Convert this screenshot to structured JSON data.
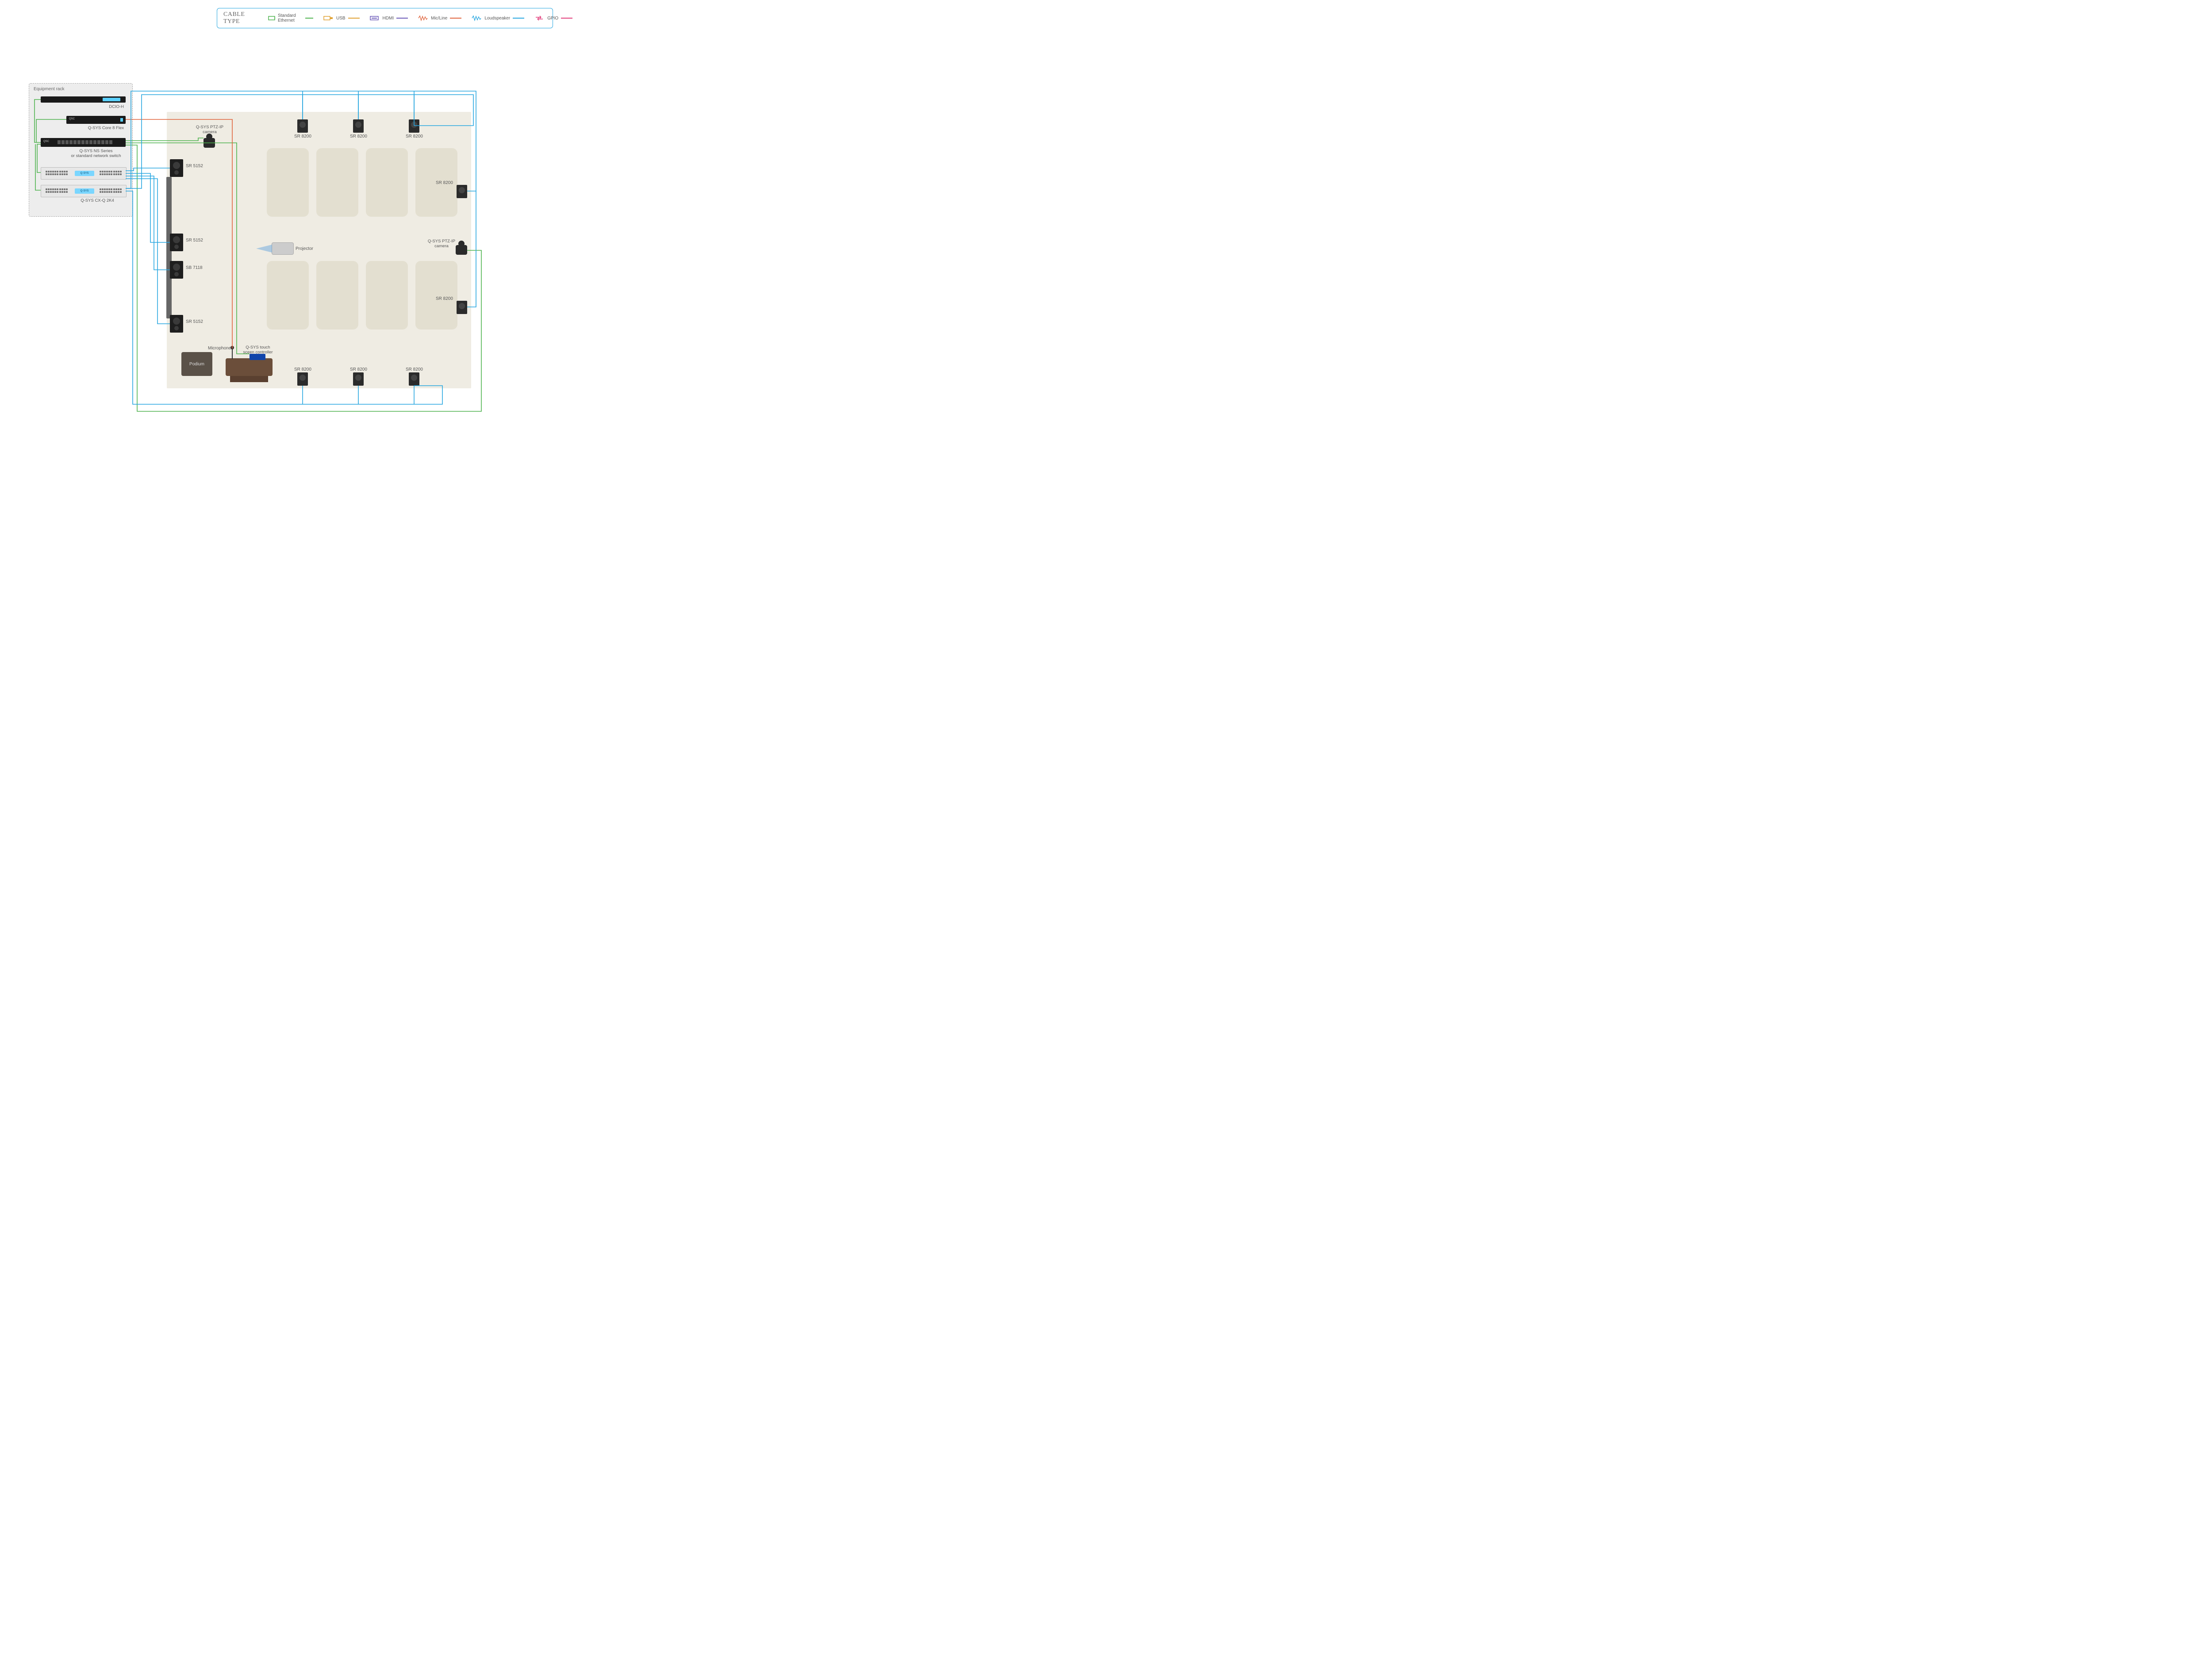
{
  "legend": {
    "title": "CABLE TYPE",
    "items": [
      {
        "label": "Standard Ethernet",
        "color": "#4db24d"
      },
      {
        "label": "USB",
        "color": "#e0a030"
      },
      {
        "label": "HDMI",
        "color": "#6a58b8"
      },
      {
        "label": "Mic/Line",
        "color": "#e0623a"
      },
      {
        "label": "Loudspeaker",
        "color": "#26a6e0"
      },
      {
        "label": "GPIO",
        "color": "#e23c7a"
      }
    ]
  },
  "rack": {
    "title": "Equipment rack",
    "devices": [
      {
        "id": "dcio",
        "label": "DCIO-H"
      },
      {
        "id": "core",
        "label": "Q-SYS Core 8 Flex"
      },
      {
        "id": "switch",
        "label": "Q-SYS NS Series\nor standard network switch"
      },
      {
        "id": "amp1",
        "label": ""
      },
      {
        "id": "amp2",
        "label": "Q-SYS CX-Q 2K4"
      }
    ]
  },
  "room": {
    "projector_label": "Projector",
    "camera_label": "Q-SYS PTZ-IP\ncamera",
    "tsc_label": "Q-SYS touch\nsceen controller",
    "mic_label": "Microphone",
    "podium_label": "Podium",
    "speakers_large": [
      {
        "id": "sr5152-1",
        "label": "SR 5152"
      },
      {
        "id": "sr5152-2",
        "label": "SR 5152"
      },
      {
        "id": "sb7118",
        "label": "SB 7118"
      },
      {
        "id": "sr5152-3",
        "label": "SR 5152"
      }
    ],
    "speakers_perimeter": [
      {
        "label": "SR 8200"
      },
      {
        "label": "SR 8200"
      },
      {
        "label": "SR 8200"
      },
      {
        "label": "SR 8200"
      },
      {
        "label": "SR 8200"
      },
      {
        "label": "SR 8200"
      },
      {
        "label": "SR 8200"
      },
      {
        "label": "SR 8200"
      }
    ]
  },
  "colors": {
    "ethernet": "#4db24d",
    "usb": "#e0a030",
    "hdmi": "#6a58b8",
    "micline": "#e0623a",
    "speaker": "#26a6e0",
    "gpio": "#e23c7a"
  }
}
